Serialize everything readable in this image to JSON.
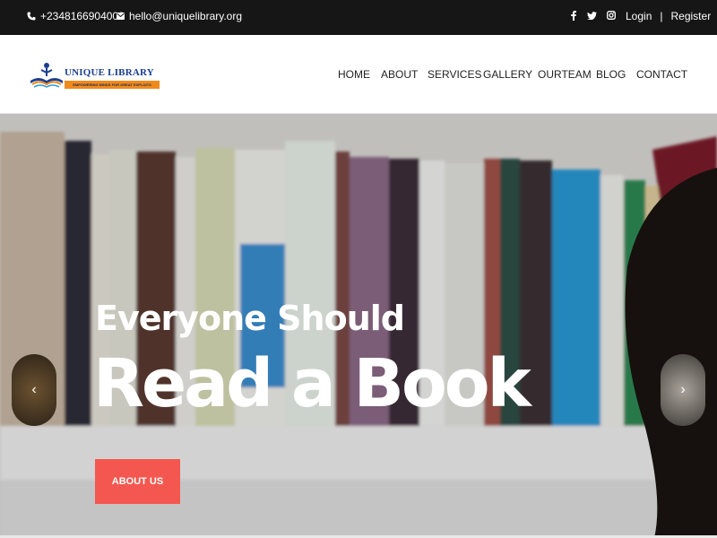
{
  "topbar": {
    "phone": "+2348166904000",
    "email": "hello@uniquelibrary.org",
    "social_icons": [
      "facebook-icon",
      "twitter-icon",
      "instagram-icon"
    ],
    "login": "Login",
    "separator": "|",
    "register": "Register"
  },
  "header": {
    "logo_name": "UNIQUE LIBRARY",
    "logo_tagline": "EMPOWERING MINDS FOR GREAT EXPLOITS",
    "nav": [
      "HOME",
      "ABOUT",
      "SERVICES",
      "GALLERY",
      "OURTEAM",
      "BLOG",
      "CONTACT"
    ]
  },
  "hero": {
    "line1": "Everyone Should",
    "line2": "Read a Book",
    "cta": "ABOUT US",
    "prev_glyph": "‹",
    "next_glyph": "›"
  },
  "colors": {
    "topbar_bg": "#161616",
    "accent_button": "#f4574f",
    "logo_blue": "#1b3f8f",
    "logo_orange": "#f08a1c"
  }
}
